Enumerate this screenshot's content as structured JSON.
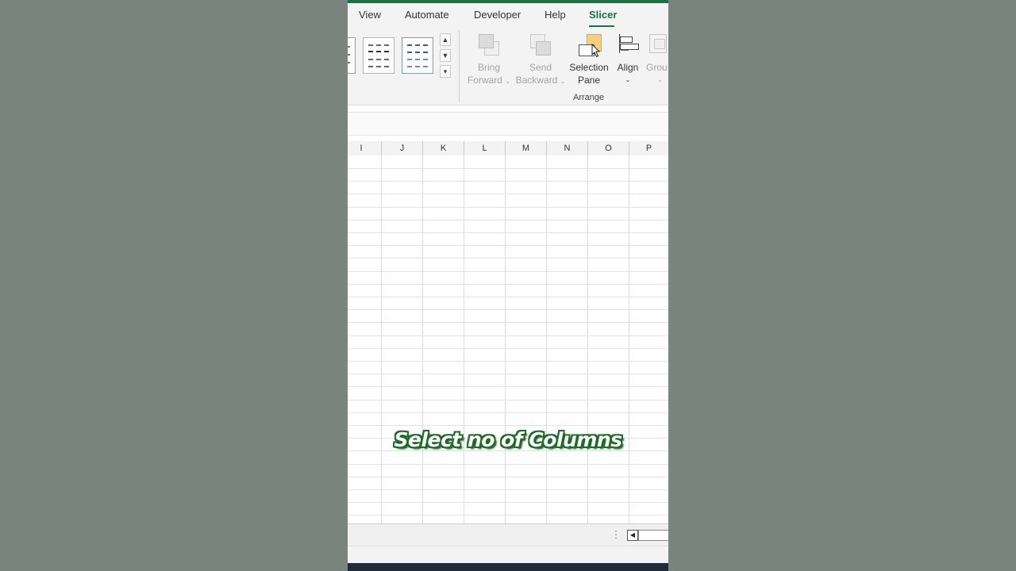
{
  "ribbon_tabs": [
    {
      "label": "View",
      "active": false
    },
    {
      "label": "Automate",
      "active": false
    },
    {
      "label": "Developer",
      "active": false
    },
    {
      "label": "Help",
      "active": false
    },
    {
      "label": "Slicer",
      "active": true
    }
  ],
  "arrange_group": {
    "label": "Arrange",
    "bring_forward": {
      "line1": "Bring",
      "line2": "Forward",
      "enabled": false
    },
    "send_backward": {
      "line1": "Send",
      "line2": "Backward",
      "enabled": false
    },
    "selection_pane": {
      "line1": "Selection",
      "line2": "Pane",
      "enabled": true
    },
    "align": {
      "line1": "Align",
      "enabled": true
    },
    "group": {
      "line1": "Grou",
      "enabled": false
    }
  },
  "columns": [
    "I",
    "J",
    "K",
    "L",
    "M",
    "N",
    "O",
    "P"
  ],
  "caption": "Select no of Columns",
  "colors": {
    "accent": "#1e7145",
    "caption_outline": "#1f6b2a"
  }
}
